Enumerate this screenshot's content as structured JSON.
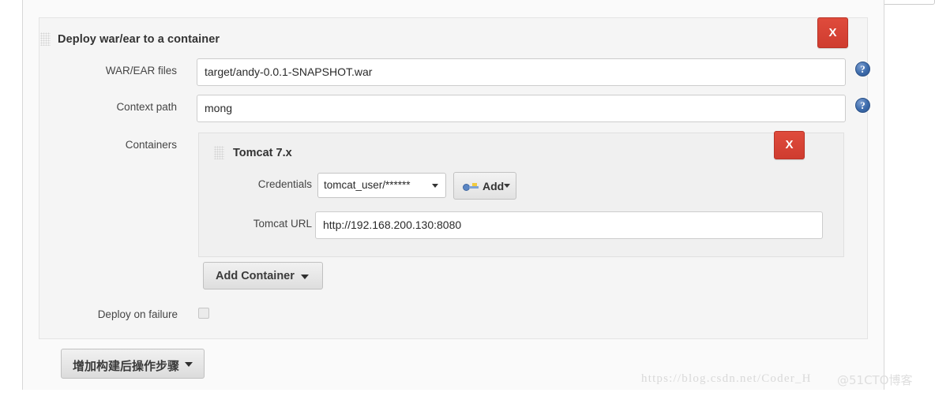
{
  "top_clipped": {
    "field_a_label": "",
    "field_b_label": ""
  },
  "postbuild_block": {
    "title": "Deploy war/ear to a container",
    "delete_label": "X",
    "rows": {
      "warear": {
        "label": "WAR/EAR files",
        "value": "target/andy-0.0.1-SNAPSHOT.war",
        "help_icon": "help-icon"
      },
      "context": {
        "label": "Context path",
        "value": "mong",
        "help_icon": "help-icon"
      },
      "containers": {
        "label": "Containers"
      },
      "deploy_on_failure": {
        "label": "Deploy on failure",
        "checked": false
      }
    },
    "container_panel": {
      "title": "Tomcat 7.x",
      "delete_label": "X",
      "credentials": {
        "label": "Credentials",
        "selected": "tomcat_user/******",
        "caret_icon": "chevron-down-icon",
        "add_button": {
          "label": "Add",
          "icon": "key-icon",
          "caret_icon": "chevron-down-icon"
        }
      },
      "tomcat_url": {
        "label": "Tomcat URL",
        "value": "http://192.168.200.130:8080"
      }
    },
    "add_container_button": {
      "label": "Add Container",
      "caret_icon": "chevron-down-icon"
    }
  },
  "add_step_button": {
    "label": "增加构建后操作步骤",
    "caret_icon": "chevron-down-icon"
  },
  "watermark": {
    "url": "https://blog.csdn.net/Coder_H",
    "brand": "@51CTO博客"
  },
  "colors": {
    "delete_red": "#d5412f",
    "help_blue": "#3c6bab",
    "panel_bg": "#f5f5f5",
    "subpanel_bg": "#f0f0f0"
  }
}
